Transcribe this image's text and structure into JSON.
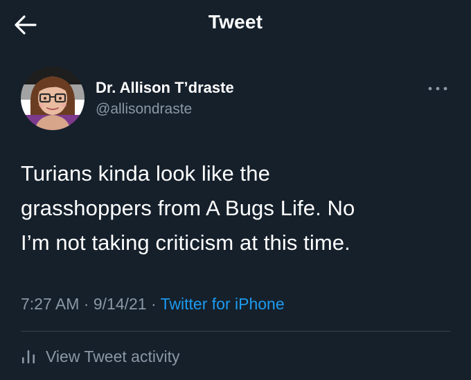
{
  "header": {
    "title": "Tweet",
    "back_icon": "arrow-left-icon"
  },
  "author": {
    "display_name": "Dr. Allison T’draste",
    "handle": "@allisondraste",
    "avatar_icon": "avatar-cartoon-woman-glasses",
    "more_icon": "ellipsis-icon"
  },
  "tweet": {
    "lines": [
      "Turians kinda look like the",
      "grasshoppers from A Bugs Life. No",
      "I’m not taking criticism at this time."
    ]
  },
  "meta": {
    "time": "7:27 AM",
    "separator": "·",
    "date": "9/14/21",
    "source": "Twitter for iPhone"
  },
  "activity": {
    "label": "View Tweet activity",
    "icon": "bar-chart-icon"
  },
  "colors": {
    "background": "#15202b",
    "text_primary": "#ffffff",
    "text_secondary": "#8b98a5",
    "accent": "#1d9bf0",
    "divider": "#38444d"
  }
}
